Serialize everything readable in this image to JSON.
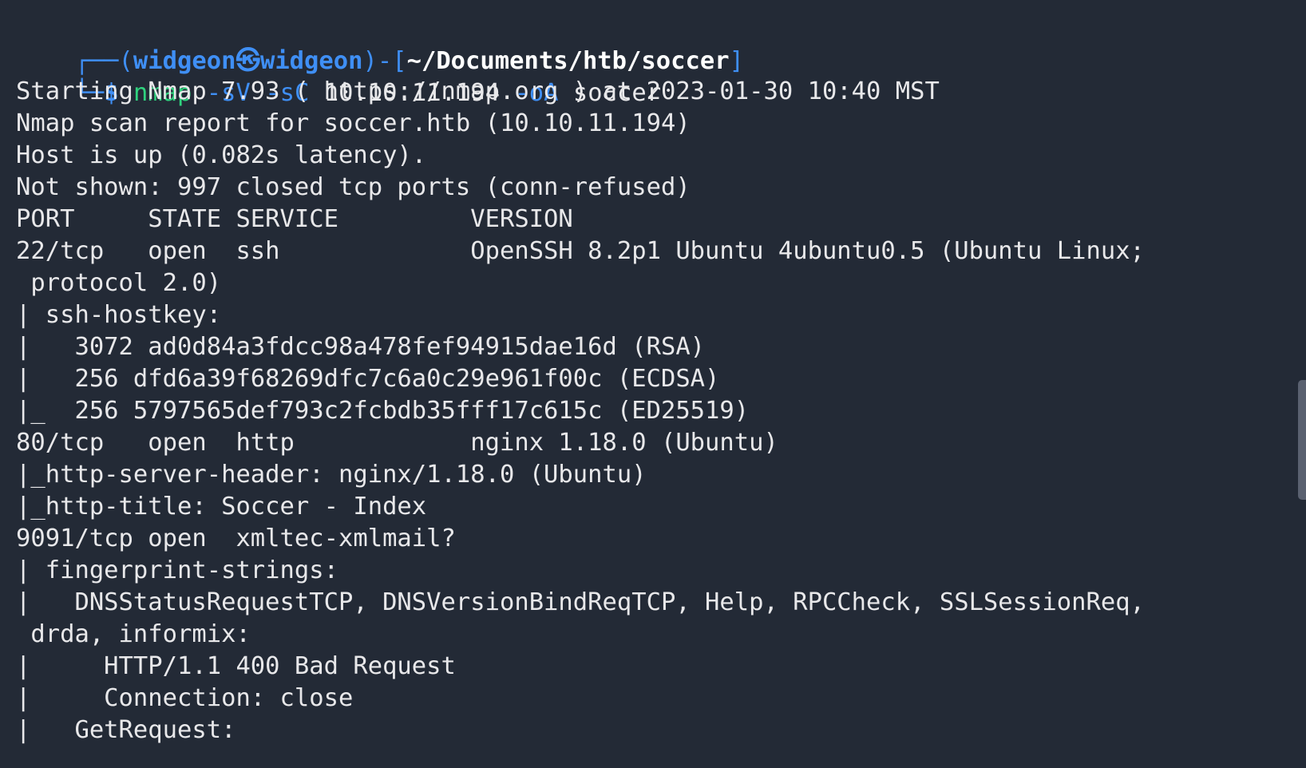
{
  "prompt": {
    "open": "┌──(",
    "user": "widgeon",
    "at_symbol": "㉿",
    "host": "widgeon",
    "mid": ")-[",
    "path": "~/Documents/htb/soccer",
    "close": "]",
    "line2_prefix": "└─",
    "dollar": "$",
    "command": "nmap",
    "flag1": "-sV",
    "flag2": "-sC",
    "target": "10.10.11.194",
    "flag3": "-oA",
    "output_name": "soccer"
  },
  "output_lines": [
    "Starting Nmap 7.93 ( https://nmap.org ) at 2023-01-30 10:40 MST",
    "Nmap scan report for soccer.htb (10.10.11.194)",
    "Host is up (0.082s latency).",
    "Not shown: 997 closed tcp ports (conn-refused)",
    "PORT     STATE SERVICE         VERSION",
    "22/tcp   open  ssh             OpenSSH 8.2p1 Ubuntu 4ubuntu0.5 (Ubuntu Linux;",
    " protocol 2.0)",
    "| ssh-hostkey:",
    "|   3072 ad0d84a3fdcc98a478fef94915dae16d (RSA)",
    "|   256 dfd6a39f68269dfc7c6a0c29e961f00c (ECDSA)",
    "|_  256 5797565def793c2fcbdb35fff17c615c (ED25519)",
    "80/tcp   open  http            nginx 1.18.0 (Ubuntu)",
    "|_http-server-header: nginx/1.18.0 (Ubuntu)",
    "|_http-title: Soccer - Index",
    "9091/tcp open  xmltec-xmlmail?",
    "| fingerprint-strings:",
    "|   DNSStatusRequestTCP, DNSVersionBindReqTCP, Help, RPCCheck, SSLSessionReq,",
    " drda, informix:",
    "|     HTTP/1.1 400 Bad Request",
    "|     Connection: close",
    "|   GetRequest:"
  ],
  "colors": {
    "background": "#232a36",
    "text": "#e8e8ea",
    "prompt_blue": "#3f8ff5",
    "command_green": "#2fd27e"
  }
}
